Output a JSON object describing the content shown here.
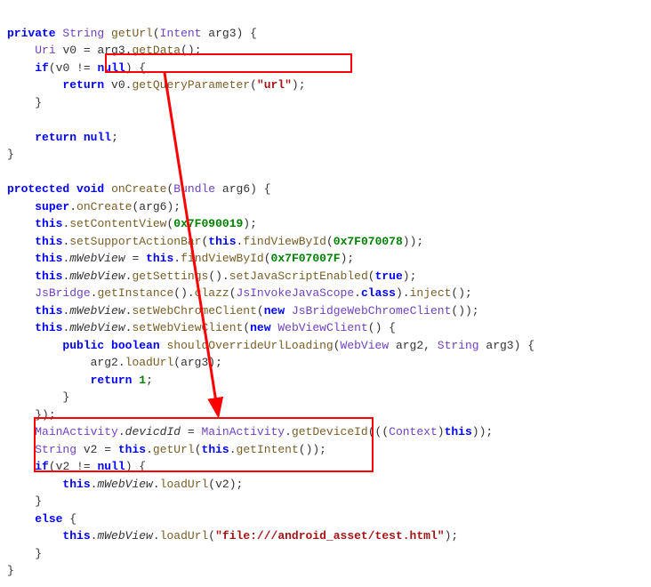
{
  "code": {
    "l1": {
      "kw1": "private",
      "sp1": " ",
      "type1": "String",
      "sp2": " ",
      "m1": "getUrl",
      "p1": "(",
      "type2": "Intent",
      "sp3": " ",
      "a1": "arg3",
      "p2": ") {"
    },
    "l2": {
      "ind": "    ",
      "type1": "Uri",
      "sp1": " ",
      "v1": "v0",
      "eq": " = ",
      "a1": "arg3",
      "dot": ".",
      "m1": "getData",
      "p1": "();"
    },
    "l3": {
      "ind": "    ",
      "kw1": "if",
      "p1": "(",
      "v1": "v0",
      "ne": " != ",
      "kw2": "null",
      "p2": ") {"
    },
    "l4": {
      "ind": "        ",
      "kw1": "return",
      "sp": " ",
      "v1": "v0",
      "dot": ".",
      "m1": "getQueryParameter",
      "p1": "(",
      "s1": "\"url\"",
      "p2": ");"
    },
    "l5": {
      "ind": "    ",
      "b": "}"
    },
    "l6": {
      "blank": " "
    },
    "l7": {
      "ind": "    ",
      "kw1": "return",
      "sp": " ",
      "kw2": "null",
      "sc": ";"
    },
    "l8": {
      "b": "}"
    },
    "l9": {
      "blank": " "
    },
    "l10": {
      "kw1": "protected",
      "sp1": " ",
      "kw2": "void",
      "sp2": " ",
      "m1": "onCreate",
      "p1": "(",
      "type1": "Bundle",
      "sp3": " ",
      "a1": "arg6",
      "p2": ") {"
    },
    "l11": {
      "ind": "    ",
      "kw1": "super",
      "dot": ".",
      "m1": "onCreate",
      "p1": "(",
      "a1": "arg6",
      "p2": ");"
    },
    "l12": {
      "ind": "    ",
      "kw1": "this",
      "dot": ".",
      "m1": "setContentView",
      "p1": "(",
      "n1": "0x7F090019",
      "p2": ");"
    },
    "l13": {
      "ind": "    ",
      "kw1": "this",
      "dot": ".",
      "m1": "setSupportActionBar",
      "p1": "(",
      "kw2": "this",
      "dot2": ".",
      "m2": "findViewById",
      "p2": "(",
      "n1": "0x7F070078",
      "p3": "));"
    },
    "l14": {
      "ind": "    ",
      "kw1": "this",
      "dot": ".",
      "f1": "mWebView",
      "eq": " = ",
      "kw2": "this",
      "dot2": ".",
      "m1": "findViewById",
      "p1": "(",
      "n1": "0x7F07007F",
      "p2": ");"
    },
    "l15": {
      "ind": "    ",
      "kw1": "this",
      "dot": ".",
      "f1": "mWebView",
      "dot2": ".",
      "m1": "getSettings",
      "p1": "()",
      "dot3": ".",
      "m2": "setJavaScriptEnabled",
      "p2": "(",
      "kw2": "true",
      "p3": ");"
    },
    "l16": {
      "ind": "    ",
      "type1": "JsBridge",
      "dot": ".",
      "m1": "getInstance",
      "p1": "()",
      "dot2": ".",
      "m2": "clazz",
      "p2": "(",
      "type2": "JsInvokeJavaScope",
      "dot3": ".",
      "kw1": "class",
      "p3": ")",
      "dot4": ".",
      "m3": "inject",
      "p4": "();"
    },
    "l17": {
      "ind": "    ",
      "kw1": "this",
      "dot": ".",
      "f1": "mWebView",
      "dot2": ".",
      "m1": "setWebChromeClient",
      "p1": "(",
      "kw2": "new",
      "sp": " ",
      "type1": "JsBridgeWebChromeClient",
      "p2": "());"
    },
    "l18": {
      "ind": "    ",
      "kw1": "this",
      "dot": ".",
      "f1": "mWebView",
      "dot2": ".",
      "m1": "setWebViewClient",
      "p1": "(",
      "kw2": "new",
      "sp": " ",
      "type1": "WebViewClient",
      "p2": "() {"
    },
    "l19": {
      "ind": "        ",
      "kw1": "public",
      "sp1": " ",
      "kw2": "boolean",
      "sp2": " ",
      "m1": "shouldOverrideUrlLoading",
      "p1": "(",
      "type1": "WebView",
      "sp3": " ",
      "a1": "arg2",
      "c": ", ",
      "type2": "String",
      "sp4": " ",
      "a2": "arg3",
      "p2": ") {"
    },
    "l20": {
      "ind": "            ",
      "a1": "arg2",
      "dot": ".",
      "m1": "loadUrl",
      "p1": "(",
      "a2": "arg3",
      "p2": ");"
    },
    "l21": {
      "ind": "            ",
      "kw1": "return",
      "sp": " ",
      "n1": "1",
      "sc": ";"
    },
    "l22": {
      "ind": "        ",
      "b": "}"
    },
    "l23": {
      "ind": "    ",
      "b": "});"
    },
    "l24": {
      "ind": "    ",
      "type1": "MainActivity",
      "dot": ".",
      "f1": "devicdId",
      "eq": " = ",
      "type2": "MainActivity",
      "dot2": ".",
      "m1": "getDeviceId",
      "p1": "(((",
      "type3": "Context",
      "p2": ")",
      "kw1": "this",
      "p3": "));"
    },
    "l25": {
      "ind": "    ",
      "type1": "String",
      "sp": " ",
      "v1": "v2",
      "eq": " = ",
      "kw1": "this",
      "dot": ".",
      "m1": "getUrl",
      "p1": "(",
      "kw2": "this",
      "dot2": ".",
      "m2": "getIntent",
      "p2": "());"
    },
    "l26": {
      "ind": "    ",
      "kw1": "if",
      "p1": "(",
      "v1": "v2",
      "ne": " != ",
      "kw2": "null",
      "p2": ") {"
    },
    "l27": {
      "ind": "        ",
      "kw1": "this",
      "dot": ".",
      "f1": "mWebView",
      "dot2": ".",
      "m1": "loadUrl",
      "p1": "(",
      "v1": "v2",
      "p2": ");"
    },
    "l28": {
      "ind": "    ",
      "b": "}"
    },
    "l29": {
      "ind": "    ",
      "kw1": "else",
      "sp": " ",
      "b": "{"
    },
    "l30": {
      "ind": "        ",
      "kw1": "this",
      "dot": ".",
      "f1": "mWebView",
      "dot2": ".",
      "m1": "loadUrl",
      "p1": "(",
      "s1": "\"file:///android_asset/test.html\"",
      "p2": ");"
    },
    "l31": {
      "ind": "    ",
      "b": "}"
    },
    "l32": {
      "b": "}"
    }
  }
}
